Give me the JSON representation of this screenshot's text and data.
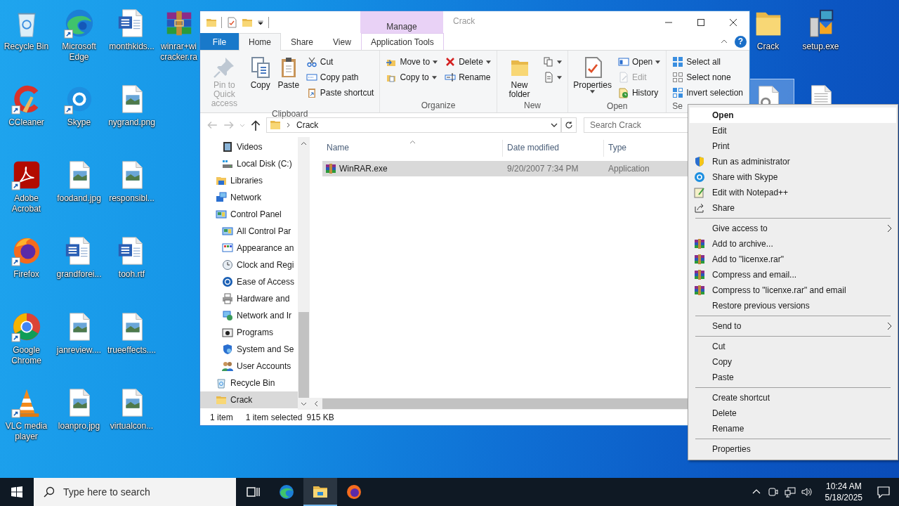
{
  "desktop": {
    "left_columns": [
      [
        {
          "label": "Recycle Bin",
          "kind": "recycle-bin",
          "shortcut": false,
          "selected": false
        },
        {
          "label": "CCleaner",
          "kind": "cleaner",
          "shortcut": true,
          "selected": false
        },
        {
          "label": "Adobe Acrobat",
          "kind": "pdf",
          "shortcut": true,
          "selected": false
        },
        {
          "label": "Firefox",
          "kind": "firefox",
          "shortcut": true,
          "selected": false
        },
        {
          "label": "Google Chrome",
          "kind": "chrome",
          "shortcut": true,
          "selected": false
        },
        {
          "label": "VLC media player",
          "kind": "cone",
          "shortcut": true,
          "selected": false
        }
      ],
      [
        {
          "label": "Microsoft Edge",
          "kind": "edge",
          "shortcut": true,
          "selected": false
        },
        {
          "label": "Skype",
          "kind": "chat",
          "shortcut": true,
          "selected": false
        },
        {
          "label": "foodand.jpg",
          "kind": "image",
          "shortcut": false,
          "selected": false
        },
        {
          "label": "grandforei...",
          "kind": "word",
          "shortcut": false,
          "selected": false
        },
        {
          "label": "janreview....",
          "kind": "image",
          "shortcut": false,
          "selected": false
        },
        {
          "label": "loanpro.jpg",
          "kind": "image",
          "shortcut": false,
          "selected": false
        }
      ],
      [
        {
          "label": "monthkids...",
          "kind": "word",
          "shortcut": false,
          "selected": false
        },
        {
          "label": "nygrand.png",
          "kind": "image",
          "shortcut": false,
          "selected": false
        },
        {
          "label": "responsibl...",
          "kind": "image",
          "shortcut": false,
          "selected": false
        },
        {
          "label": "tooh.rtf",
          "kind": "word",
          "shortcut": false,
          "selected": false
        },
        {
          "label": "trueeffects....",
          "kind": "image",
          "shortcut": false,
          "selected": false
        },
        {
          "label": "virtualcon...",
          "kind": "image",
          "shortcut": false,
          "selected": false
        }
      ],
      [
        {
          "label": "winrar+wi cracker.ra",
          "kind": "archive",
          "shortcut": false,
          "selected": false
        }
      ]
    ],
    "right_columns": [
      [
        {
          "label": "Crack",
          "kind": "folder",
          "shortcut": false,
          "selected": false
        },
        {
          "kind": "settings-file",
          "selected": true
        }
      ],
      [
        {
          "label": "setup.exe",
          "kind": "installer",
          "shortcut": false,
          "selected": false
        },
        {
          "kind": "text-file",
          "selected": false
        }
      ]
    ]
  },
  "window": {
    "title": "Crack",
    "context_tab": "Manage",
    "help": "?"
  },
  "ribbon_tabs": [
    {
      "label": "File",
      "kind": "file",
      "selected": false
    },
    {
      "label": "Home",
      "kind": "normal",
      "selected": true
    },
    {
      "label": "Share",
      "kind": "normal",
      "selected": false
    },
    {
      "label": "View",
      "kind": "normal",
      "selected": false
    },
    {
      "label": "Application Tools",
      "kind": "contextual",
      "selected": false
    }
  ],
  "ribbon_groups": [
    {
      "label": "Clipboard",
      "controls": [
        {
          "kind": "large",
          "label": "Pin to Quick access",
          "disabled": true,
          "dropdown": false
        },
        {
          "kind": "large",
          "label": "Copy",
          "disabled": false,
          "dropdown": false
        },
        {
          "kind": "large",
          "label": "Paste",
          "disabled": false,
          "dropdown": false
        },
        {
          "kind": "stack",
          "items": [
            {
              "label": "Cut",
              "disabled": false,
              "dropdown": false
            },
            {
              "label": "Copy path",
              "disabled": false,
              "dropdown": false
            },
            {
              "label": "Paste shortcut",
              "disabled": false,
              "dropdown": false
            }
          ]
        }
      ]
    },
    {
      "label": "Organize",
      "controls": [
        {
          "kind": "stack",
          "items": [
            {
              "label": "Move to",
              "disabled": false,
              "dropdown": true
            },
            {
              "label": "Copy to",
              "disabled": false,
              "dropdown": true
            }
          ]
        },
        {
          "kind": "stack",
          "items": [
            {
              "label": "Delete",
              "disabled": false,
              "dropdown": true
            },
            {
              "label": "Rename",
              "disabled": false,
              "dropdown": false
            }
          ]
        }
      ]
    },
    {
      "label": "New",
      "controls": [
        {
          "kind": "large",
          "label": "New folder",
          "disabled": false,
          "dropdown": false
        },
        {
          "kind": "stack",
          "items": [
            {
              "disabled": false,
              "dropdown": true
            },
            {
              "disabled": false,
              "dropdown": true
            }
          ]
        }
      ]
    },
    {
      "label": "Open",
      "controls": [
        {
          "kind": "large",
          "label": "Properties",
          "disabled": false,
          "dropdown": true
        },
        {
          "kind": "stack",
          "items": [
            {
              "label": "Open",
              "disabled": false,
              "dropdown": true
            },
            {
              "label": "Edit",
              "disabled": true,
              "dropdown": false
            },
            {
              "label": "History",
              "disabled": false,
              "dropdown": false
            }
          ]
        }
      ]
    },
    {
      "label": "Se",
      "controls": [
        {
          "kind": "stack",
          "items": [
            {
              "label": "Select all",
              "disabled": false,
              "dropdown": false
            },
            {
              "label": "Select none",
              "disabled": false,
              "dropdown": false
            },
            {
              "label": "Invert selection",
              "disabled": false,
              "dropdown": false
            }
          ]
        }
      ]
    }
  ],
  "address_bar": {
    "path": [
      "Crack"
    ]
  },
  "search": {
    "placeholder": "Search Crack"
  },
  "nav_pane": {
    "items": [
      {
        "children": [
          {
            "label": "Videos",
            "selected": false
          },
          {
            "label": "Local Disk (C:)",
            "selected": false
          }
        ]
      },
      {
        "label": "Libraries",
        "selected": false
      },
      {
        "label": "Network",
        "selected": false
      },
      {
        "label": "Control Panel",
        "selected": false,
        "children": [
          {
            "label": "All Control Par",
            "selected": false
          },
          {
            "label": "Appearance an",
            "selected": false
          },
          {
            "label": "Clock and Regi",
            "selected": false
          },
          {
            "label": "Ease of Access",
            "selected": false
          },
          {
            "label": "Hardware and",
            "selected": false
          },
          {
            "label": "Network and Ir",
            "selected": false
          },
          {
            "label": "Programs",
            "selected": false
          },
          {
            "label": "System and Se",
            "selected": false
          },
          {
            "label": "User Accounts",
            "selected": false
          }
        ]
      },
      {
        "label": "Recycle Bin",
        "selected": false
      },
      {
        "label": "Crack",
        "selected": true
      }
    ]
  },
  "file_list": {
    "columns": [
      {
        "label": "Name",
        "sorted": true
      },
      {
        "label": "Date modified",
        "sorted": false
      },
      {
        "label": "Type",
        "sorted": false
      }
    ],
    "rows": [
      {
        "cells": [
          "WinRAR.exe",
          "9/20/2007 7:34 PM",
          "Application"
        ],
        "selected": true
      }
    ]
  },
  "status_bar": [
    "1 item",
    "1 item selected",
    "915 KB"
  ],
  "context_menu": {
    "sections": [
      {
        "items": [
          {
            "label": "Open",
            "kind": "plain",
            "default": true,
            "selected": true,
            "submenu": false
          },
          {
            "label": "Edit",
            "kind": "plain",
            "default": false,
            "selected": false,
            "submenu": false
          },
          {
            "label": "Print",
            "kind": "plain",
            "default": false,
            "selected": false,
            "submenu": false
          },
          {
            "label": "Run as administrator",
            "kind": "shield",
            "default": false,
            "selected": false,
            "submenu": false
          },
          {
            "label": "Share with Skype",
            "kind": "chat",
            "default": false,
            "selected": false,
            "submenu": false
          },
          {
            "label": "Edit with Notepad++",
            "kind": "notepad",
            "default": false,
            "selected": false,
            "submenu": false
          },
          {
            "label": "Share",
            "kind": "share",
            "default": false,
            "selected": false,
            "submenu": false
          }
        ]
      },
      {
        "items": [
          {
            "label": "Give access to",
            "kind": "plain",
            "default": false,
            "selected": false,
            "submenu": true
          },
          {
            "label": "Add to archive...",
            "kind": "archive",
            "default": false,
            "selected": false,
            "submenu": false
          },
          {
            "label": "Add to \"licenxe.rar\"",
            "kind": "archive",
            "default": false,
            "selected": false,
            "submenu": false
          },
          {
            "label": "Compress and email...",
            "kind": "archive",
            "default": false,
            "selected": false,
            "submenu": false
          },
          {
            "label": "Compress to \"licenxe.rar\" and email",
            "kind": "archive",
            "default": false,
            "selected": false,
            "submenu": false
          },
          {
            "label": "Restore previous versions",
            "kind": "plain",
            "default": false,
            "selected": false,
            "submenu": false
          }
        ]
      },
      {
        "items": [
          {
            "label": "Send to",
            "kind": "plain",
            "default": false,
            "selected": false,
            "submenu": true
          }
        ]
      },
      {
        "items": [
          {
            "label": "Cut",
            "kind": "plain",
            "default": false,
            "selected": false,
            "submenu": false
          },
          {
            "label": "Copy",
            "kind": "plain",
            "default": false,
            "selected": false,
            "submenu": false
          },
          {
            "label": "Paste",
            "kind": "plain",
            "default": false,
            "selected": false,
            "submenu": false
          }
        ]
      },
      {
        "items": [
          {
            "label": "Create shortcut",
            "kind": "plain",
            "default": false,
            "selected": false,
            "submenu": false
          },
          {
            "label": "Delete",
            "kind": "plain",
            "default": false,
            "selected": false,
            "submenu": false
          },
          {
            "label": "Rename",
            "kind": "plain",
            "default": false,
            "selected": false,
            "submenu": false
          }
        ]
      },
      {
        "items": [
          {
            "label": "Properties",
            "kind": "plain",
            "default": false,
            "selected": false,
            "submenu": false
          }
        ]
      }
    ]
  },
  "taskbar": {
    "search_placeholder": "Type here to search",
    "apps": [
      {
        "kind": "task-view",
        "active": false
      },
      {
        "kind": "edge",
        "active": false
      },
      {
        "kind": "explorer",
        "active": true
      },
      {
        "kind": "firefox",
        "active": false
      }
    ],
    "time": "10:24 AM",
    "date": "5/18/2025"
  }
}
